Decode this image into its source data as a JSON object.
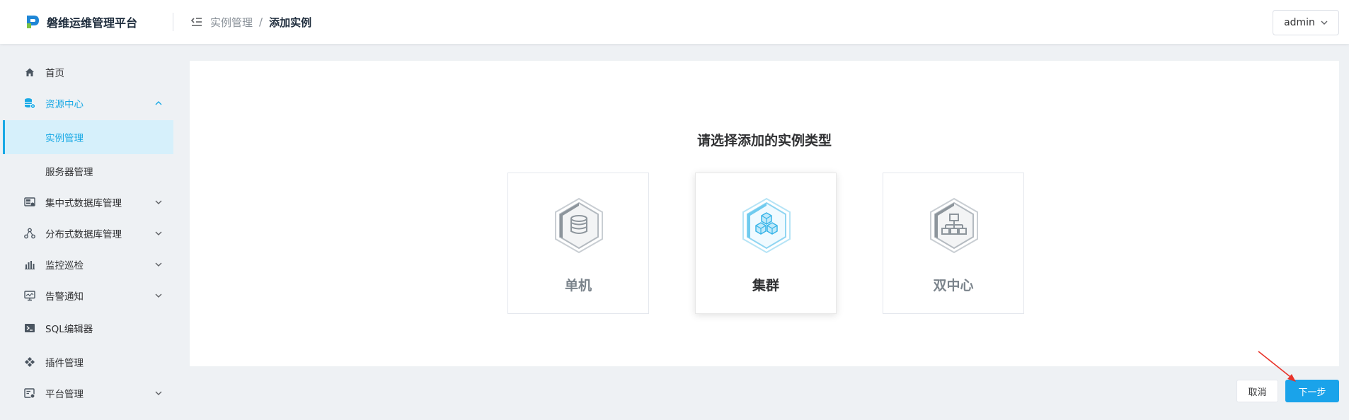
{
  "app": {
    "title": "磐维运维管理平台"
  },
  "header": {
    "breadcrumb": [
      "实例管理",
      "添加实例"
    ],
    "separator": "/",
    "user": "admin"
  },
  "sidebar": {
    "items": [
      {
        "label": "首页",
        "icon": "home-icon"
      },
      {
        "label": "资源中心",
        "icon": "database-settings-icon",
        "expanded": true
      },
      {
        "label": "实例管理",
        "sub": true,
        "active": true
      },
      {
        "label": "服务器管理",
        "sub": true
      },
      {
        "label": "集中式数据库管理",
        "icon": "centralized-db-icon",
        "expandable": true
      },
      {
        "label": "分布式数据库管理",
        "icon": "distributed-db-icon",
        "expandable": true
      },
      {
        "label": "监控巡检",
        "icon": "bar-chart-icon",
        "expandable": true
      },
      {
        "label": "告警通知",
        "icon": "monitor-alert-icon",
        "expandable": true
      },
      {
        "label": "SQL编辑器",
        "icon": "terminal-icon"
      },
      {
        "label": "插件管理",
        "icon": "plugin-icon"
      },
      {
        "label": "平台管理",
        "icon": "platform-settings-icon",
        "expandable": true
      }
    ]
  },
  "main": {
    "title": "请选择添加的实例类型",
    "options": [
      {
        "label": "单机",
        "icon": "database-icon",
        "selected": false
      },
      {
        "label": "集群",
        "icon": "cubes-icon",
        "selected": true
      },
      {
        "label": "双中心",
        "icon": "hierarchy-icon",
        "selected": false
      }
    ]
  },
  "footer": {
    "cancel": "取消",
    "next": "下一步"
  },
  "colors": {
    "accent": "#19a9e5",
    "primary_button": "#1aa3ea",
    "active_bg": "#d6f0fb",
    "annotation": "#e8332a"
  }
}
